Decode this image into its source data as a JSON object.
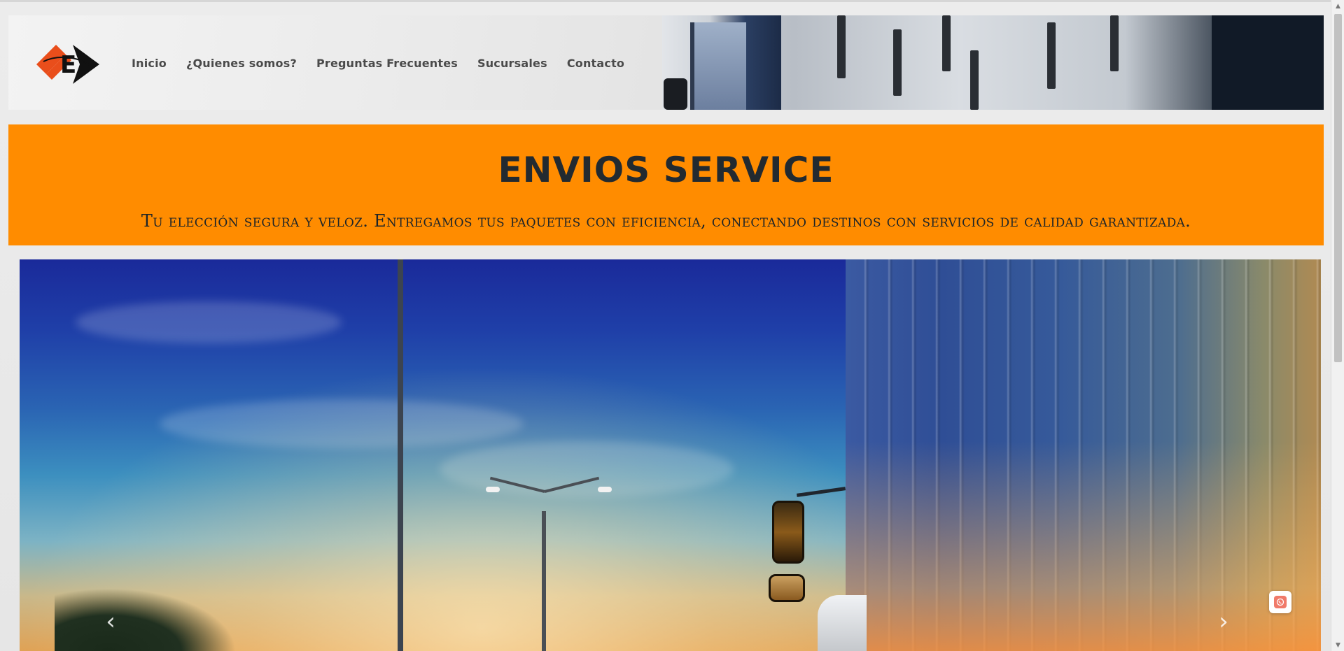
{
  "header": {
    "logo": "envios-logo",
    "nav": [
      {
        "label": "Inicio"
      },
      {
        "label": "¿Quienes somos?"
      },
      {
        "label": "Preguntas Frecuentes"
      },
      {
        "label": "Sucursales"
      },
      {
        "label": "Contacto"
      }
    ]
  },
  "band": {
    "title": "ENVIOS SERVICE",
    "tagline": "Tu elección segura y veloz. Entregamos tus paquetes con eficiencia, conectando destinos con servicios de calidad garantizada."
  },
  "hero": {
    "prev_icon": "chevron-left-icon",
    "next_icon": "chevron-right-icon",
    "prev_glyph": "‹",
    "next_glyph": "›"
  },
  "floating": {
    "icon": "whatsapp-icon"
  },
  "colors": {
    "band": "#ff8c00",
    "title": "#222a30",
    "nav_text": "#4a4a4a",
    "page_bg": "#e7e7e7"
  }
}
